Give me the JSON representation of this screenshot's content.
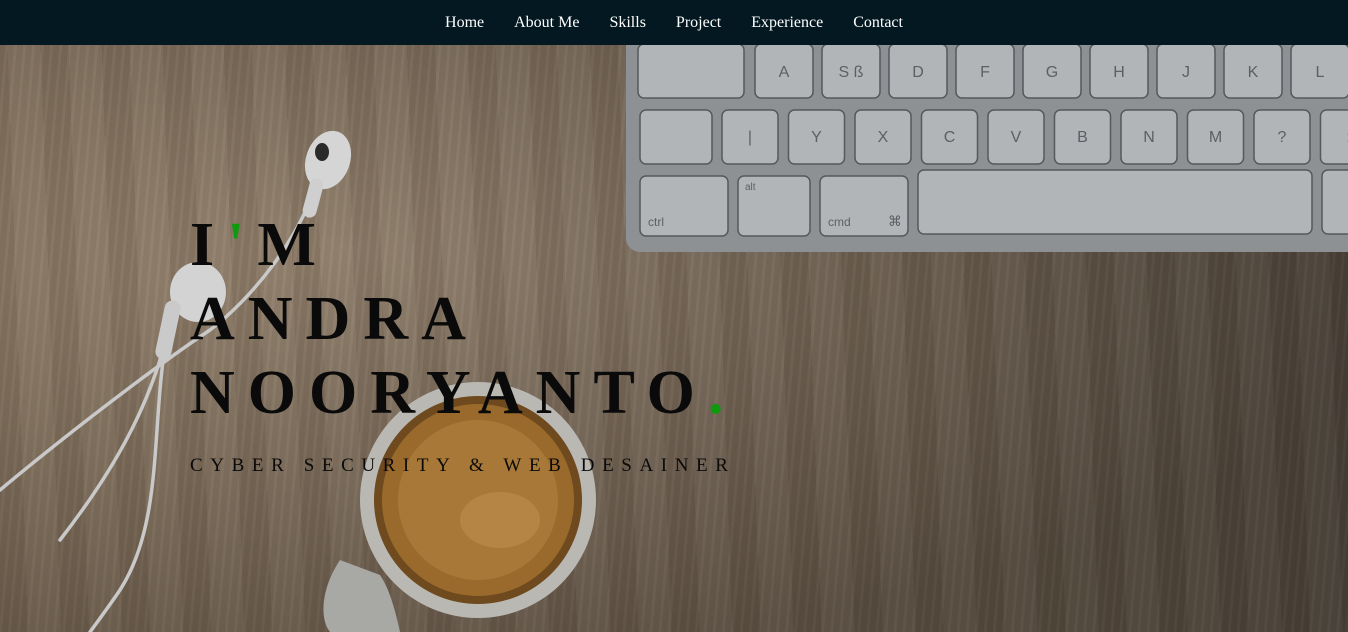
{
  "nav": {
    "items": [
      {
        "label": "Home"
      },
      {
        "label": "About Me"
      },
      {
        "label": "Skills"
      },
      {
        "label": "Project"
      },
      {
        "label": "Experience"
      },
      {
        "label": "Contact"
      }
    ]
  },
  "hero": {
    "line1_start": "I",
    "line1_apostrophe": "'",
    "line1_end": "M",
    "line2": "ANDRA",
    "line3": "NOORYANTO",
    "line3_dot": ".",
    "tagline": "CYBER SECURITY & WEB DESAINER"
  },
  "keyboard": {
    "row1": [
      "A",
      "S ß",
      "D",
      "F",
      "G",
      "H",
      "J",
      "K",
      "L"
    ],
    "row2": [
      "|",
      "Y",
      "X",
      "C",
      "V",
      "B",
      "N",
      "M",
      "?",
      ":"
    ],
    "row3": [
      "ctrl",
      "alt",
      "cmd",
      "⌘"
    ]
  },
  "colors": {
    "nav_bg": "#031820",
    "accent": "#0d9a0d",
    "text": "#0a0a0a"
  }
}
